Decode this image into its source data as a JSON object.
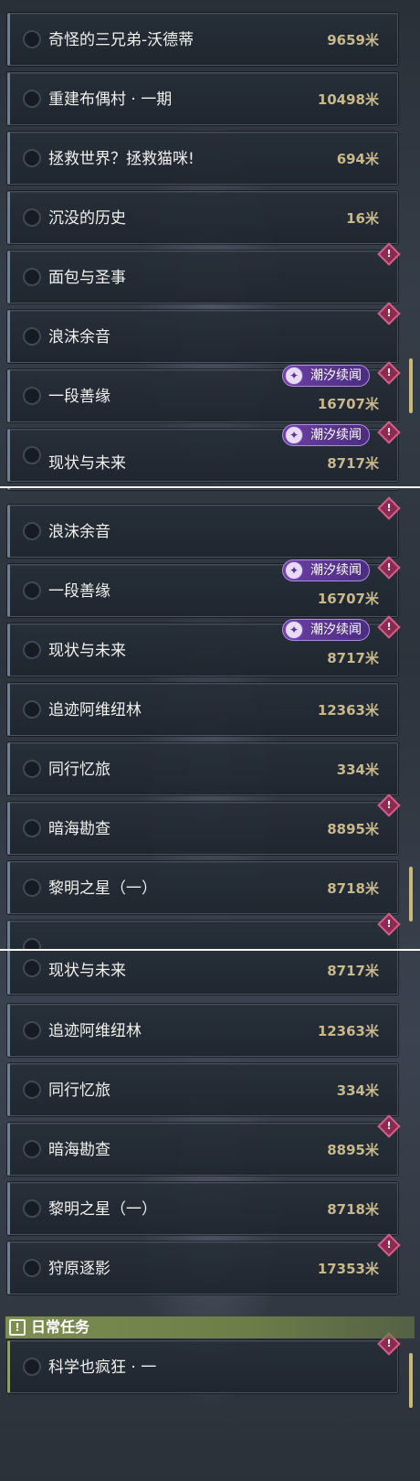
{
  "icons": {
    "alert": "!",
    "badge": "✦",
    "header": "!"
  },
  "colors": {
    "distance": "#c9b88a",
    "badge_purple": "#6b3fa2",
    "alert_diamond": "#8c2b4f",
    "daily_header": "#7d8e52",
    "scrollbar": "#c8b879"
  },
  "tide_badge_label": "潮汐续闻",
  "panel1": {
    "rows": [
      {
        "name": "奇怪的三兄弟-沃德蒂",
        "distance": "9659米"
      },
      {
        "name": "重建布偶村 · 一期",
        "distance": "10498米"
      },
      {
        "name": "拯救世界？拯救猫咪!",
        "distance": "694米"
      },
      {
        "name": "沉没的历史",
        "distance": "16米"
      },
      {
        "name": "面包与圣事",
        "distance": ""
      },
      {
        "name": "浪沫余音",
        "distance": ""
      },
      {
        "name": "一段善缘",
        "distance": "16707米"
      },
      {
        "name": "现状与未来",
        "distance": "8717米"
      }
    ]
  },
  "panel2": {
    "rows": [
      {
        "name": "浪沫余音",
        "distance": ""
      },
      {
        "name": "一段善缘",
        "distance": "16707米"
      },
      {
        "name": "现状与未来",
        "distance": "8717米"
      },
      {
        "name": "追迹阿维纽林",
        "distance": "12363米"
      },
      {
        "name": "同行忆旅",
        "distance": "334米"
      },
      {
        "name": "暗海勘查",
        "distance": "8895米"
      },
      {
        "name": "黎明之星（一）",
        "distance": "8718米"
      }
    ]
  },
  "panel3": {
    "rows": [
      {
        "name": "现状与未来",
        "distance": "8717米"
      },
      {
        "name": "追迹阿维纽林",
        "distance": "12363米"
      },
      {
        "name": "同行忆旅",
        "distance": "334米"
      },
      {
        "name": "暗海勘查",
        "distance": "8895米"
      },
      {
        "name": "黎明之星（一）",
        "distance": "8718米"
      },
      {
        "name": "狩原逐影",
        "distance": "17353米"
      }
    ],
    "daily_header": "日常任务",
    "daily_rows": [
      {
        "name": "科学也疯狂 · 一",
        "distance": ""
      }
    ]
  }
}
